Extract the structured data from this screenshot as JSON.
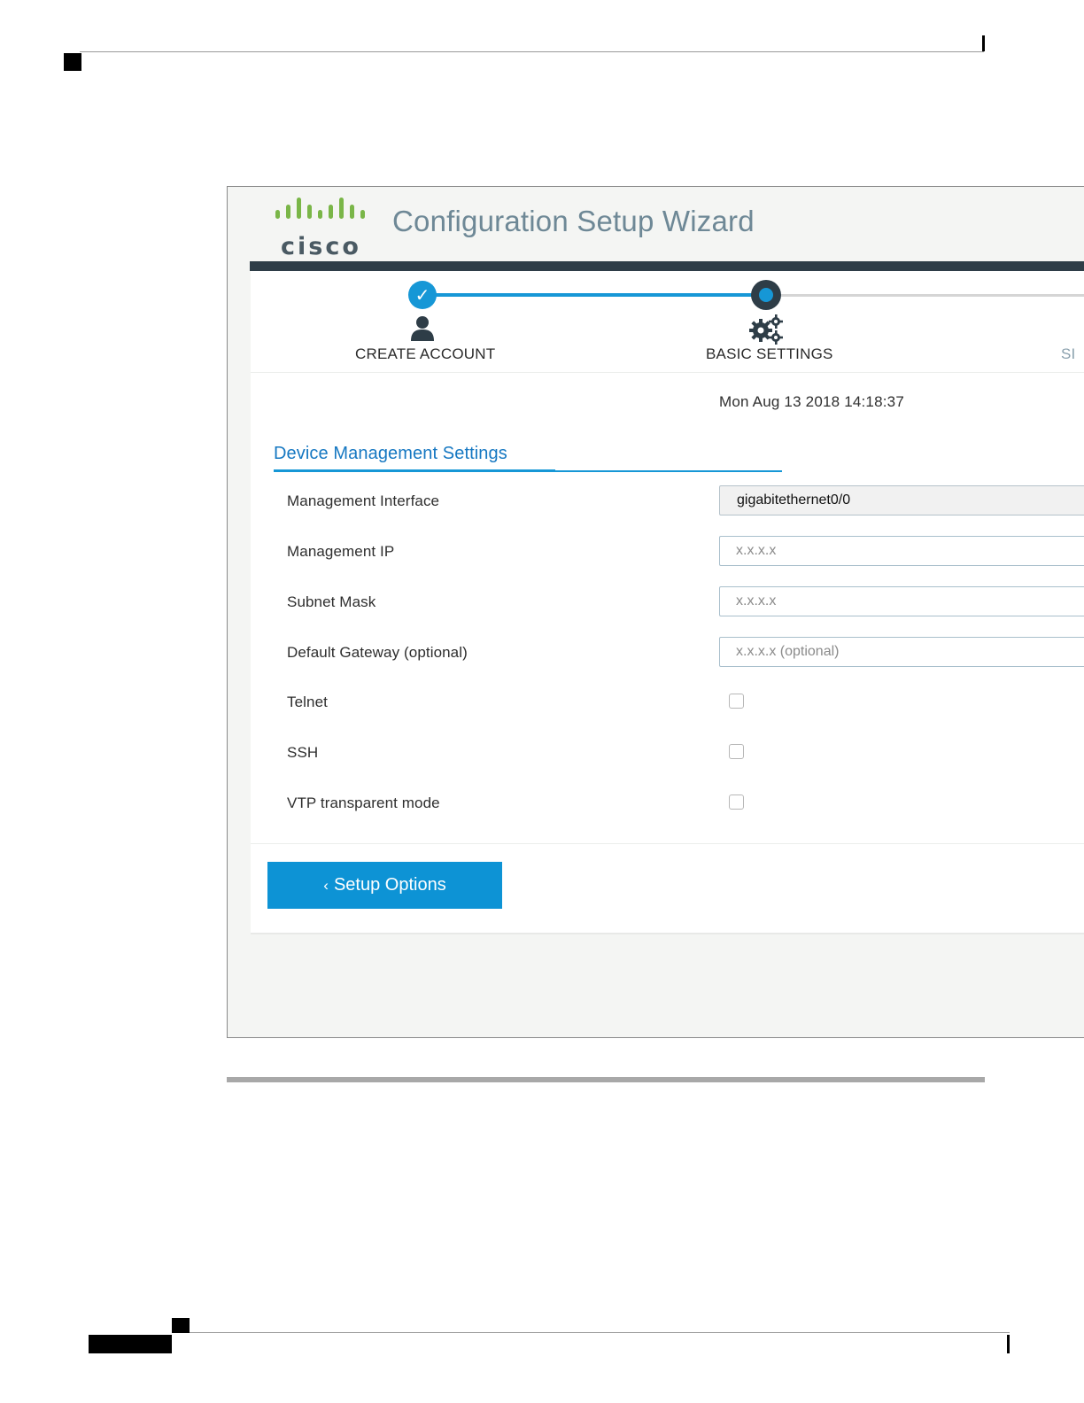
{
  "app": {
    "logo_text": "cisco",
    "title": "Configuration Setup Wizard"
  },
  "steps": [
    {
      "label": "CREATE ACCOUNT",
      "state": "complete",
      "icon": "user-icon"
    },
    {
      "label": "BASIC SETTINGS",
      "state": "current",
      "icon": "gears-icon"
    },
    {
      "label": "SI",
      "state": "upcoming"
    }
  ],
  "timestamp": "Mon Aug 13 2018 14:18:37",
  "section": {
    "title": "Device Management Settings"
  },
  "form": {
    "management_interface": {
      "label": "Management Interface",
      "value": "gigabitethernet0/0"
    },
    "management_ip": {
      "label": "Management IP",
      "placeholder": "x.x.x.x"
    },
    "subnet_mask": {
      "label": "Subnet Mask",
      "placeholder": "x.x.x.x"
    },
    "default_gateway": {
      "label": "Default Gateway (optional)",
      "placeholder": "x.x.x.x (optional)"
    },
    "telnet": {
      "label": "Telnet",
      "checked": false
    },
    "ssh": {
      "label": "SSH",
      "checked": false
    },
    "vtp": {
      "label": "VTP transparent mode",
      "checked": false
    }
  },
  "buttons": {
    "back_label": "Setup Options"
  },
  "colors": {
    "accent": "#1697d6",
    "header_band": "#2e3d47",
    "title_text": "#6e8896",
    "section_title": "#1678c2",
    "button": "#0d93d5",
    "logo_bars": "#7ab648"
  }
}
